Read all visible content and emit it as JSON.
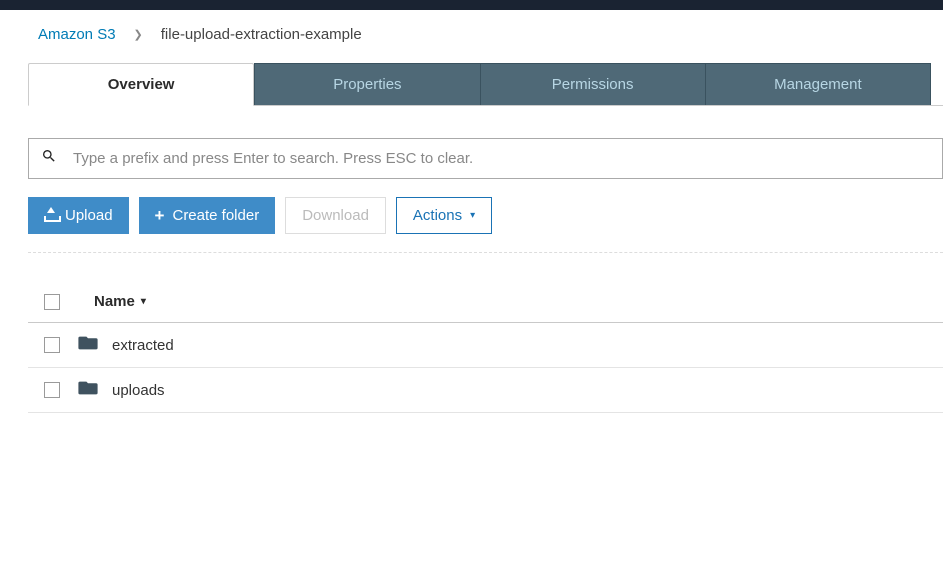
{
  "breadcrumb": {
    "root": "Amazon S3",
    "current": "file-upload-extraction-example"
  },
  "tabs": {
    "overview": "Overview",
    "properties": "Properties",
    "permissions": "Permissions",
    "management": "Management"
  },
  "search": {
    "placeholder": "Type a prefix and press Enter to search. Press ESC to clear."
  },
  "toolbar": {
    "upload": "Upload",
    "create_folder": "Create folder",
    "download": "Download",
    "actions": "Actions"
  },
  "list": {
    "header_name": "Name",
    "items": [
      {
        "name": "extracted"
      },
      {
        "name": "uploads"
      }
    ]
  }
}
